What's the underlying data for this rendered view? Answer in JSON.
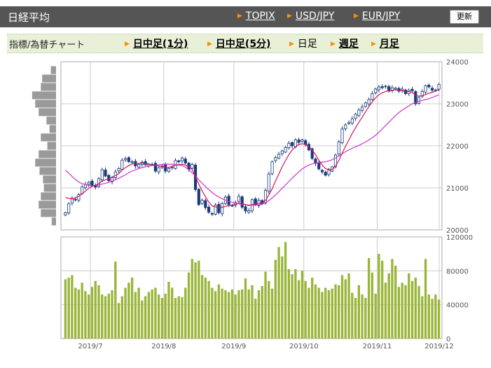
{
  "header": {
    "title": "日経平均",
    "links": [
      "TOPIX",
      "USD/JPY",
      "EUR/JPY"
    ],
    "refresh_label": "更新"
  },
  "tabs": {
    "label": "指標/為替チャート",
    "items": [
      {
        "label": "日中足(1分)",
        "active": false
      },
      {
        "label": "日中足(5分)",
        "active": false
      },
      {
        "label": "日足",
        "active": true
      },
      {
        "label": "週足",
        "active": false
      },
      {
        "label": "月足",
        "active": false
      }
    ]
  },
  "colors": {
    "candle_up": "#ffffff",
    "candle_down": "#1a3a7a",
    "candle_outline": "#1a3a7a",
    "ma_short": "#d4145a",
    "ma_long": "#cc33cc",
    "volume_bar": "#99b53a",
    "volume_profile": "#9a9a9a",
    "grid": "#cccccc"
  },
  "chart_data": {
    "type": "candlestick",
    "x_ticks": [
      "2019/7",
      "2019/8",
      "2019/9",
      "2019/10",
      "2019/11",
      "2019/12"
    ],
    "price_axis": {
      "ticks": [
        20000,
        21000,
        22000,
        23000,
        24000
      ],
      "ylim": [
        20000,
        24000
      ]
    },
    "volume_axis": {
      "ticks": [
        0,
        40000,
        80000,
        120000
      ],
      "ylim": [
        0,
        120000
      ]
    },
    "close": [
      20410,
      20620,
      20750,
      20710,
      20840,
      21020,
      21080,
      21130,
      21060,
      21020,
      21220,
      21430,
      21280,
      21170,
      21240,
      21380,
      21460,
      21660,
      21690,
      21620,
      21620,
      21520,
      21560,
      21610,
      21550,
      21560,
      21560,
      21400,
      21480,
      21520,
      21400,
      21460,
      21490,
      21650,
      21620,
      21710,
      21590,
      21440,
      21560,
      20960,
      20600,
      20710,
      20530,
      20420,
      20380,
      20590,
      20410,
      20630,
      20780,
      20600,
      20580,
      20650,
      20800,
      20540,
      20450,
      20460,
      20720,
      20600,
      20700,
      20620,
      20940,
      21330,
      21620,
      21720,
      21800,
      21880,
      21960,
      22060,
      22000,
      22140,
      22080,
      22140,
      22030,
      21900,
      21700,
      21580,
      21450,
      21380,
      21300,
      21420,
      21500,
      21780,
      22090,
      22400,
      22500,
      22550,
      22640,
      22750,
      22850,
      22920,
      23020,
      23100,
      23240,
      23350,
      23400,
      23380,
      23420,
      23300,
      23380,
      23370,
      23300,
      23350,
      23240,
      23320,
      23310,
      23000,
      23150,
      23290,
      23430,
      23400,
      23320,
      23330,
      23460
    ],
    "ma_short": [
      20770,
      20750,
      20740,
      20760,
      20800,
      20860,
      20920,
      20990,
      21040,
      21060,
      21100,
      21160,
      21190,
      21220,
      21250,
      21290,
      21340,
      21420,
      21480,
      21530,
      21570,
      21580,
      21580,
      21590,
      21580,
      21570,
      21550,
      21530,
      21520,
      21510,
      21490,
      21490,
      21510,
      21540,
      21550,
      21560,
      21540,
      21490,
      21440,
      21270,
      21090,
      20930,
      20790,
      20660,
      20570,
      20550,
      20530,
      20540,
      20560,
      20580,
      20590,
      20610,
      20640,
      20630,
      20600,
      20580,
      20600,
      20620,
      20630,
      20640,
      20700,
      20830,
      20980,
      21160,
      21330,
      21500,
      21650,
      21790,
      21900,
      21980,
      22030,
      22050,
      22030,
      21980,
      21900,
      21790,
      21660,
      21540,
      21460,
      21430,
      21440,
      21520,
      21650,
      21820,
      21990,
      22140,
      22290,
      22430,
      22560,
      22680,
      22810,
      22930,
      23040,
      23140,
      23210,
      23260,
      23290,
      23310,
      23320,
      23330,
      23320,
      23310,
      23290,
      23290,
      23270,
      23200,
      23180,
      23190,
      23220,
      23250,
      23270,
      23300,
      23340
    ],
    "ma_long": [
      21420,
      21350,
      21270,
      21200,
      21140,
      21100,
      21080,
      21060,
      21050,
      21060,
      21070,
      21090,
      21110,
      21130,
      21160,
      21190,
      21230,
      21270,
      21310,
      21360,
      21400,
      21430,
      21460,
      21480,
      21500,
      21520,
      21530,
      21540,
      21550,
      21560,
      21560,
      21560,
      21560,
      21550,
      21540,
      21530,
      21490,
      21430,
      21360,
      21280,
      21190,
      21110,
      21030,
      20960,
      20890,
      20830,
      20780,
      20740,
      20710,
      20680,
      20660,
      20640,
      20620,
      20610,
      20600,
      20590,
      20590,
      20590,
      20600,
      20610,
      20650,
      20700,
      20760,
      20830,
      20910,
      20990,
      21070,
      21150,
      21230,
      21310,
      21380,
      21450,
      21500,
      21540,
      21570,
      21590,
      21600,
      21610,
      21620,
      21640,
      21670,
      21710,
      21760,
      21810,
      21860,
      21900,
      21940,
      21980,
      22010,
      22050,
      22090,
      22140,
      22190,
      22250,
      22320,
      22400,
      22480,
      22560,
      22640,
      22720,
      22790,
      22850,
      22900,
      22950,
      23000,
      23030,
      23060,
      23080,
      23100,
      23120,
      23150,
      23180,
      23210
    ],
    "volume": [
      70000,
      72000,
      75000,
      60000,
      58000,
      66000,
      56000,
      52000,
      61000,
      68000,
      63000,
      52000,
      50000,
      53000,
      57000,
      91000,
      42000,
      50000,
      60000,
      66000,
      72000,
      55000,
      60000,
      45000,
      50000,
      55000,
      58000,
      60000,
      52000,
      48000,
      53000,
      67000,
      60000,
      48000,
      50000,
      49000,
      60000,
      78000,
      94000,
      90000,
      92000,
      75000,
      72000,
      68000,
      60000,
      56000,
      64000,
      59000,
      57000,
      55000,
      58000,
      52000,
      57000,
      58000,
      71000,
      58000,
      63000,
      47000,
      57000,
      62000,
      79000,
      68000,
      59000,
      93000,
      108000,
      97000,
      114000,
      82000,
      76000,
      82000,
      69000,
      80000,
      68000,
      60000,
      72000,
      64000,
      60000,
      55000,
      60000,
      57000,
      59000,
      64000,
      63000,
      75000,
      70000,
      77000,
      54000,
      48000,
      63000,
      52000,
      48000,
      95000,
      78000,
      53000,
      100000,
      92000,
      66000,
      77000,
      94000,
      86000,
      61000,
      66000,
      63000,
      77000,
      68000,
      72000,
      62000,
      50000,
      94000,
      52000,
      47000,
      52000,
      46000
    ],
    "volume_profile_levels": [
      23800,
      23600,
      23400,
      23200,
      23000,
      22800,
      22600,
      22400,
      22200,
      22000,
      21800,
      21600,
      21400,
      21200,
      21000,
      20800,
      20600,
      20400,
      20200
    ],
    "volume_profile_values": [
      0.12,
      0.32,
      0.35,
      0.55,
      0.48,
      0.4,
      0.22,
      0.15,
      0.35,
      0.2,
      0.4,
      0.48,
      0.38,
      0.3,
      0.28,
      0.35,
      0.4,
      0.35,
      0.1
    ]
  }
}
